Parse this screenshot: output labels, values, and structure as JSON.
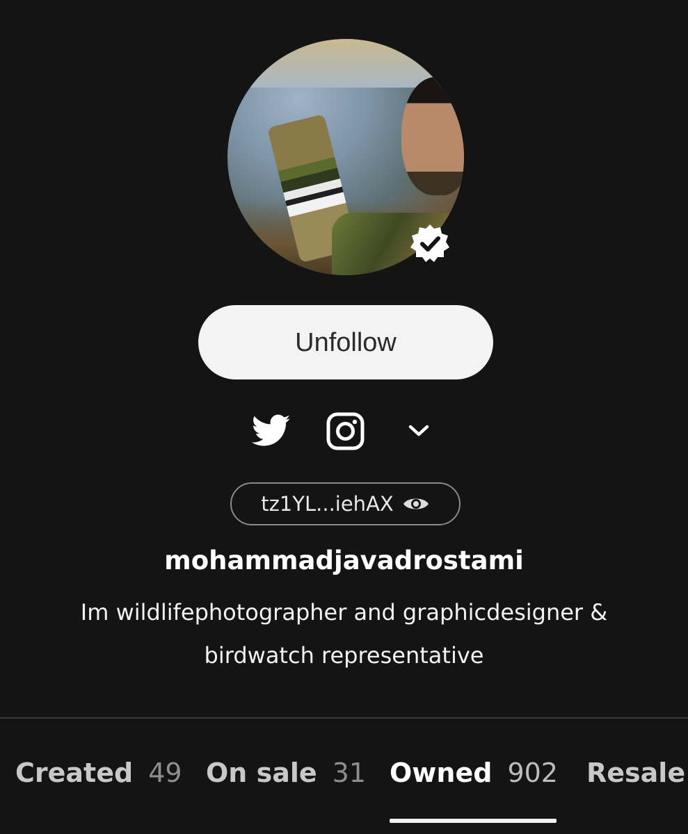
{
  "profile": {
    "follow_button_label": "Unfollow",
    "address_short": "tz1YL...iehAX",
    "username": "mohammadjavadrostami",
    "bio_line1": "Im wildlifephotographer and graphicdesigner &",
    "bio_line2": "birdwatch representative",
    "verified": true
  },
  "social_icons": [
    "twitter-icon",
    "instagram-icon",
    "chevron-down-icon"
  ],
  "tabs": [
    {
      "label": "Created",
      "count": "49",
      "active": false
    },
    {
      "label": "On sale",
      "count": "31",
      "active": false
    },
    {
      "label": "Owned",
      "count": "902",
      "active": true
    },
    {
      "label": "Resale",
      "count": "",
      "active": false
    }
  ],
  "colors": {
    "background": "#141414",
    "button_bg": "#f3f3f3",
    "text": "#ffffff",
    "muted": "#8e8e8e"
  }
}
